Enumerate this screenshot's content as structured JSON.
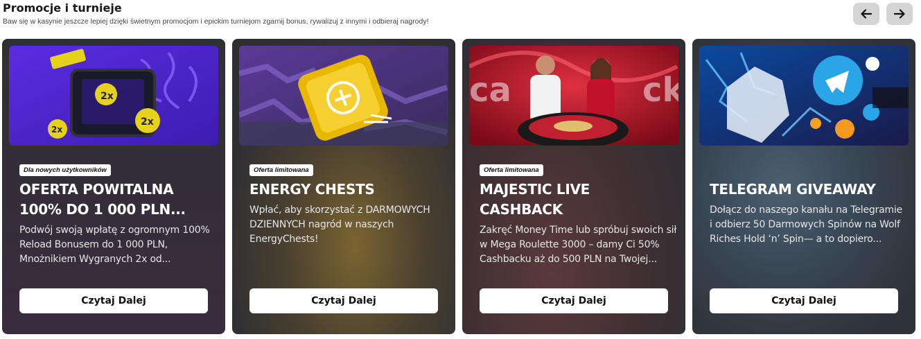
{
  "section": {
    "title": "Promocje i turnieje",
    "subtitle": "Baw się w kasynie jeszcze lepiej dzięki świetnym promocjom i epickim turniejom   zgarnij bonus, rywalizuj z innymi i odbieraj nagrody!"
  },
  "nav": {
    "prev_icon": "arrow-left-icon",
    "next_icon": "arrow-right-icon"
  },
  "cards": [
    {
      "badge": "Dla nowych użytkowników",
      "title": "OFERTA POWITALNA 100% DO 1 000 PLN...",
      "description": "Podwój swoją wpłatę z ogromnym 100% Reload Bonusem do 1 000 PLN, Mnożnikiem Wygranych 2x od...",
      "button": "Czytaj Dalej"
    },
    {
      "badge": "Oferta limitowana",
      "title": "ENERGY CHESTS",
      "description": "Wpłać, aby skorzystać z DARMOWYCH DZIENNYCH nagród w naszych EnergyChests!",
      "button": "Czytaj Dalej"
    },
    {
      "badge": "Oferta limitowana",
      "title": "MAJESTIC LIVE CASHBACK",
      "description": "Zakręć Money Time lub spróbuj swoich sił w Mega Roulette 3000 – damy Ci 50% Cashbacku aż do 500 PLN na Twojej...",
      "button": "Czytaj Dalej"
    },
    {
      "badge": "",
      "title": "TELEGRAM GIVEAWAY",
      "description": "Dołącz do naszego kanału na Telegramie i odbierz 50 Darmowych Spinów na Wolf Riches Hold ‘n’ Spin— a to dopiero...",
      "button": "Czytaj Dalej"
    }
  ]
}
